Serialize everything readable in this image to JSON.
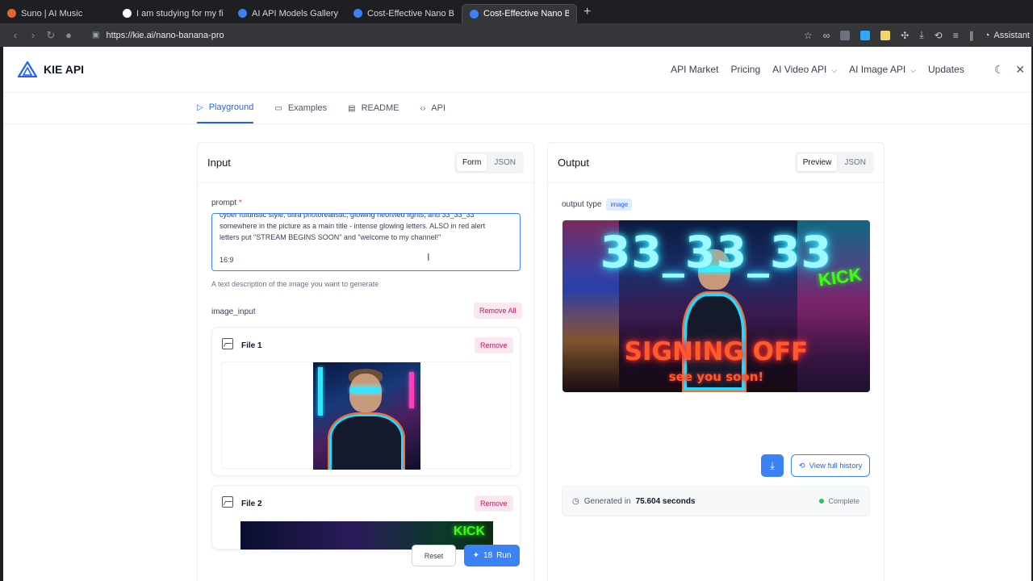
{
  "browser": {
    "tabs": [
      {
        "title": "Suno | AI Music",
        "fav": "#e8642c"
      },
      {
        "title": "I am studying for my first year",
        "fav": "#ffffff"
      },
      {
        "title": "AI API Models Gallery – Video",
        "fav": "#3b82f6"
      },
      {
        "title": "Cost-Effective Nano Banana P",
        "fav": "#3b82f6"
      },
      {
        "title": "Cost-Effective Nano Banana P",
        "fav": "#3b82f6"
      }
    ],
    "url": "https://kie.ai/nano-banana-pro",
    "assistant_label": "Assistant"
  },
  "site": {
    "brand": "KIE API",
    "nav": [
      {
        "label": "API Market"
      },
      {
        "label": "Pricing"
      },
      {
        "label": "AI Video API",
        "dropdown": true
      },
      {
        "label": "AI Image API",
        "dropdown": true
      },
      {
        "label": "Updates"
      }
    ]
  },
  "subtabs": [
    {
      "label": "Playground",
      "icon": "play-icon",
      "glyph": "▷",
      "active": true
    },
    {
      "label": "Examples",
      "icon": "book-icon",
      "glyph": "▭",
      "active": false
    },
    {
      "label": "README",
      "icon": "file-icon",
      "glyph": "▤",
      "active": false
    },
    {
      "label": "API",
      "icon": "code-icon",
      "glyph": "‹›",
      "active": false
    }
  ],
  "input": {
    "title": "Input",
    "mode_form": "Form",
    "mode_json": "JSON",
    "prompt_label": "prompt",
    "prompt_required": "*",
    "prompt_value": "cyber futuristic style, ultra photorealistic, glowing neon/led lights, and 33_33_33\nsomewhere in the picture as a main title - intense glowing letters. ALSO in red alert\nletters put \"STREAM BEGINS SOON\" and \"welcome to my channel!\"\n\n16:9",
    "prompt_hint": "A text description of the image you want to generate",
    "image_input_label": "image_input",
    "remove_all": "Remove All",
    "files": [
      {
        "title": "File 1",
        "remove": "Remove"
      },
      {
        "title": "File 2",
        "remove": "Remove"
      }
    ],
    "reset": "Reset",
    "run_cost": "18",
    "run": "Run"
  },
  "output": {
    "title": "Output",
    "mode_preview": "Preview",
    "mode_json": "JSON",
    "output_type_label": "output type",
    "output_type_value": "image",
    "image_text_title": "33_33_33",
    "image_text_sign": "SIGNING OFF",
    "image_text_soon": "see you soon!",
    "image_text_brand": "KICK",
    "view_history": "View full history",
    "generated_prefix": "Generated in",
    "generated_time": "75.604 seconds",
    "status": "Complete"
  }
}
